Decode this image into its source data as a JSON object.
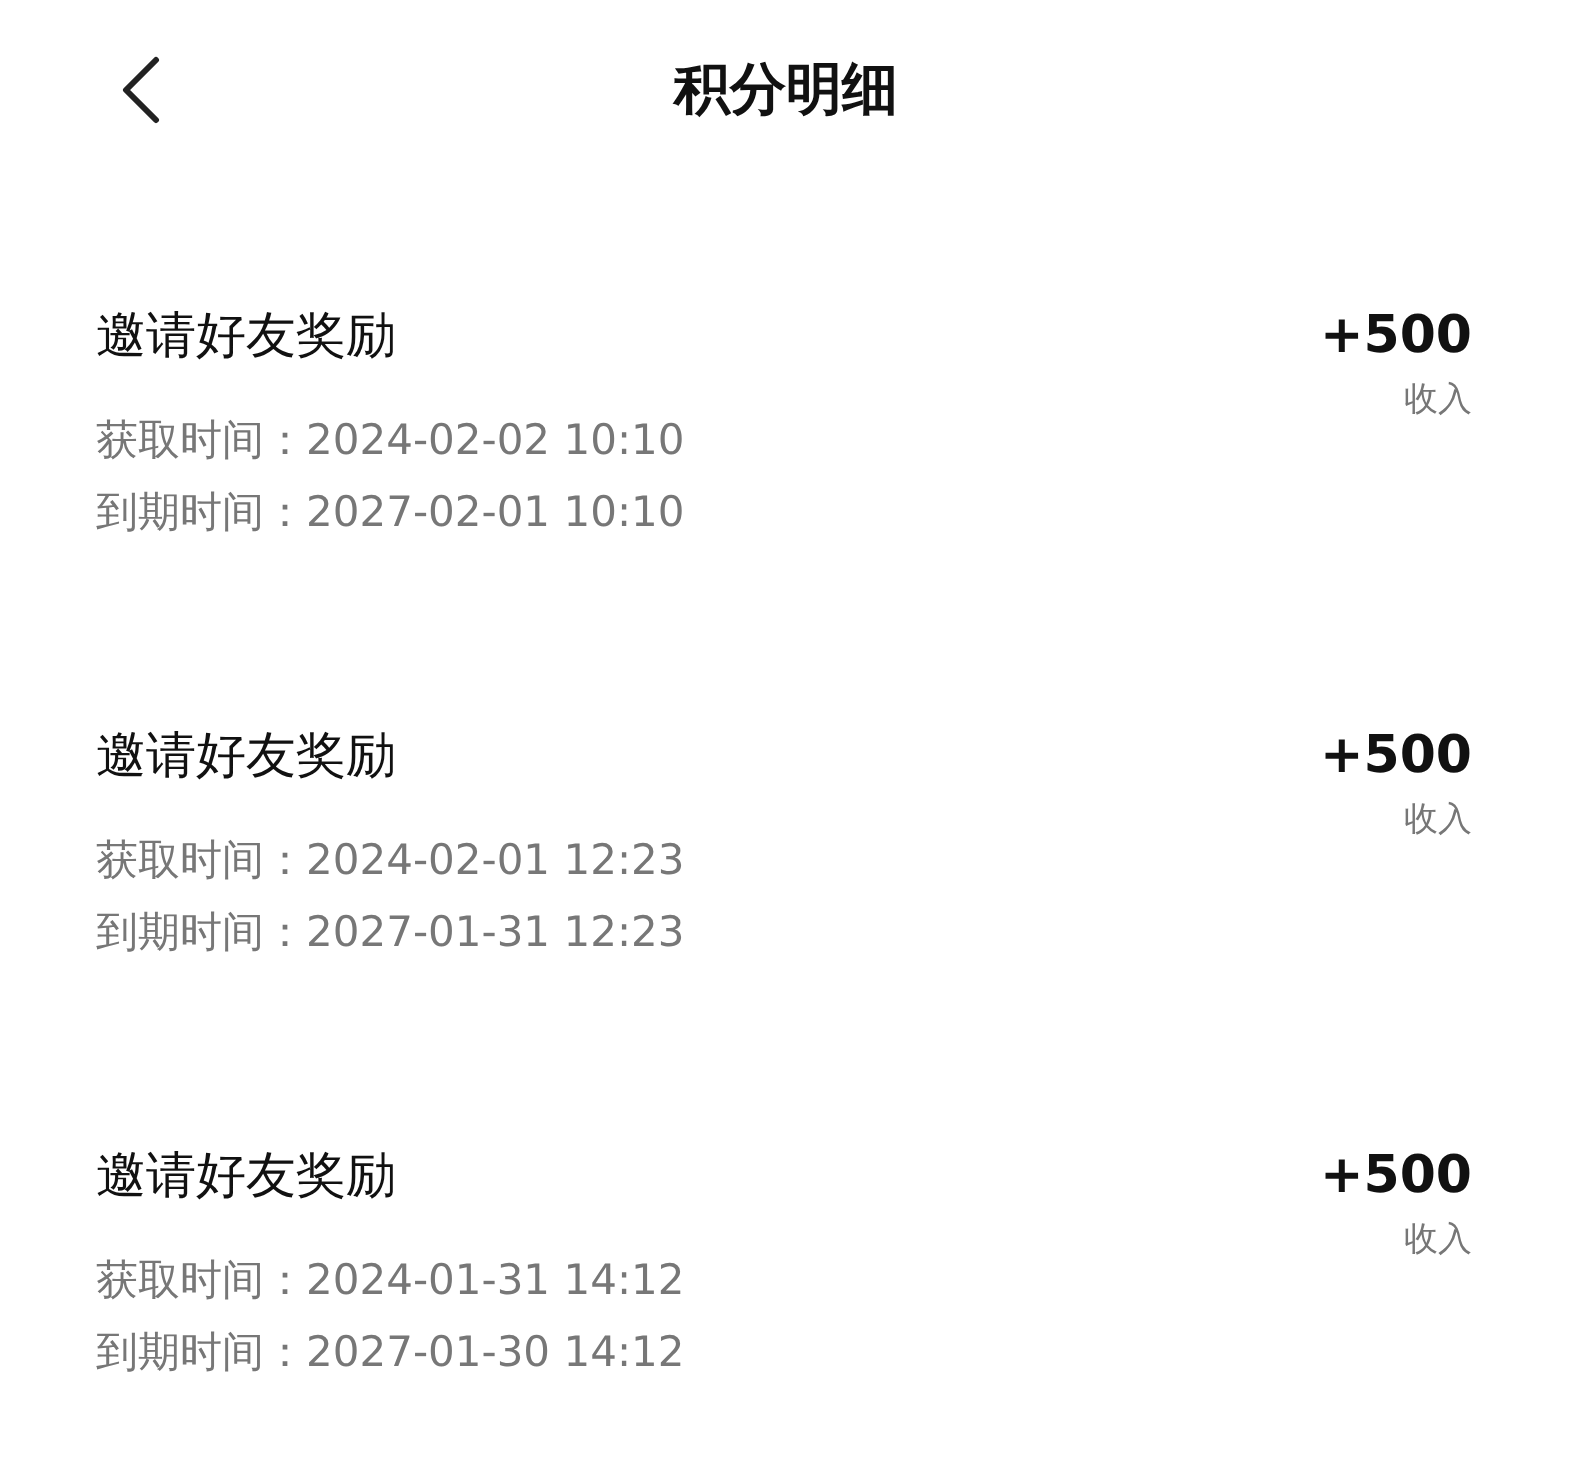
{
  "header": {
    "title": "积分明细"
  },
  "records": [
    {
      "title": "邀请好友奖励",
      "obtained_label": "获取时间：",
      "obtained": "2024-02-02 10:10",
      "expires_label": "到期时间：",
      "expires": "2027-02-01 10:10",
      "amount": "+500",
      "type": "收入"
    },
    {
      "title": "邀请好友奖励",
      "obtained_label": "获取时间：",
      "obtained": "2024-02-01 12:23",
      "expires_label": "到期时间：",
      "expires": "2027-01-31 12:23",
      "amount": "+500",
      "type": "收入"
    },
    {
      "title": "邀请好友奖励",
      "obtained_label": "获取时间：",
      "obtained": "2024-01-31 14:12",
      "expires_label": "到期时间：",
      "expires": "2027-01-30 14:12",
      "amount": "+500",
      "type": "收入"
    }
  ]
}
